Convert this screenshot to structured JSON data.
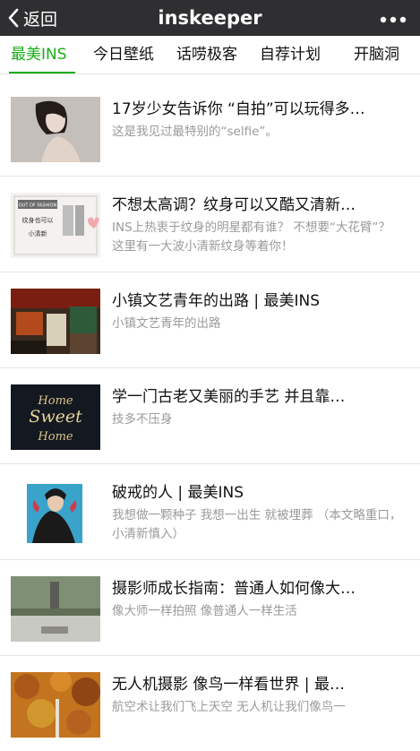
{
  "header": {
    "back_label": "返回",
    "title": "inskeeper"
  },
  "tabs": [
    {
      "label": "最美INS",
      "active": true
    },
    {
      "label": "今日壁纸",
      "active": false
    },
    {
      "label": "话唠极客",
      "active": false
    },
    {
      "label": "自荐计划",
      "active": false
    },
    {
      "label": "开脑洞",
      "active": false
    }
  ],
  "articles": [
    {
      "title": "17岁少女告诉你 “自拍”可以玩得多…",
      "desc": "这是我见过最特别的“selfie”。"
    },
    {
      "title": "不想太高调？纹身可以又酷又清新…",
      "desc": "INS上热衷于纹身的明星都有谁？ 不想要“大花臂”？ 这里有一大波小清新纹身等着你！"
    },
    {
      "title": "小镇文艺青年的出路 | 最美INS",
      "desc": "小镇文艺青年的出路"
    },
    {
      "title": "学一门古老又美丽的手艺 并且靠…",
      "desc": "技多不压身"
    },
    {
      "title": "破戒的人 | 最美INS",
      "desc": "我想做一颗种子 我想一出生 就被埋葬 （本文略重口，小清新慎入）"
    },
    {
      "title": "摄影师成长指南：普通人如何像大…",
      "desc": "像大师一样拍照 像普通人一样生活"
    },
    {
      "title": "无人机摄影 像鸟一样看世界 | 最…",
      "desc": "航空术让我们飞上天空 无人机让我们像鸟一"
    }
  ],
  "thumbnails": {
    "tattoo_card_text": [
      "OUT OF FASHION",
      "纹身也可以",
      "小清新"
    ],
    "lettering_text": [
      "Home",
      "Sweet",
      "Home"
    ]
  },
  "colors": {
    "topbar": "#2f2f31",
    "accent": "#1aad19",
    "title_text": "#111111",
    "desc_text": "#9a9a9a"
  },
  "icons": [
    "chevron-left-icon",
    "more-dots-icon"
  ]
}
